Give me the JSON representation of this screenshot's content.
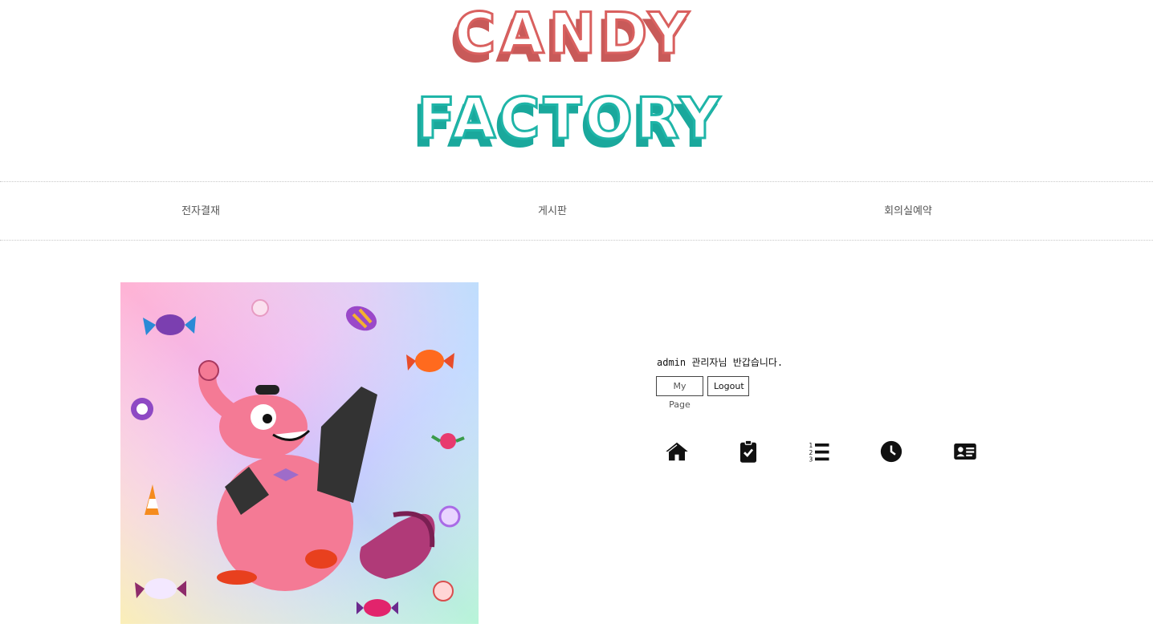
{
  "logo": {
    "line1": "CANDY",
    "line2": "FACTORY",
    "color1": "#d9605f",
    "color2": "#1fb5a8"
  },
  "nav": {
    "items": [
      "전자결재",
      "게시판",
      "회의실예약"
    ]
  },
  "user": {
    "welcome": "admin 관리자님 반갑습니다.",
    "mypage_label": "My Page",
    "logout_label": "Logout"
  },
  "quick_icons": [
    "home-icon",
    "clipboard-check-icon",
    "list-ol-icon",
    "clock-icon",
    "address-card-icon"
  ]
}
